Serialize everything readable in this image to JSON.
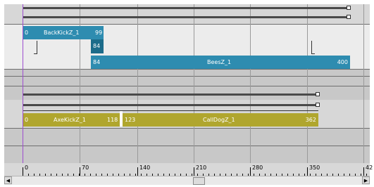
{
  "tracks": {
    "group1": {
      "clips": [
        {
          "label": "BackKickZ_1",
          "start": "0",
          "end": "99"
        },
        {
          "label": "BeesZ_1",
          "start": "84",
          "end": "400",
          "overlap_label": "84"
        }
      ]
    },
    "group2": {
      "clips": [
        {
          "label": "AxeKickZ_1",
          "start": "0",
          "end": "118"
        },
        {
          "label": "CallDogZ_1",
          "start": "123",
          "end": "362"
        }
      ]
    }
  },
  "ruler": {
    "labels": [
      "0",
      "70",
      "140",
      "210",
      "280",
      "350",
      "42"
    ]
  },
  "colors": {
    "blue_clip": "#2e8cb0",
    "olive_clip": "#b0a62e",
    "playhead": "#9d4dd0"
  },
  "scrollbar": {
    "left_icon": "arrow-left-icon",
    "right_icon": "arrow-right-icon"
  }
}
